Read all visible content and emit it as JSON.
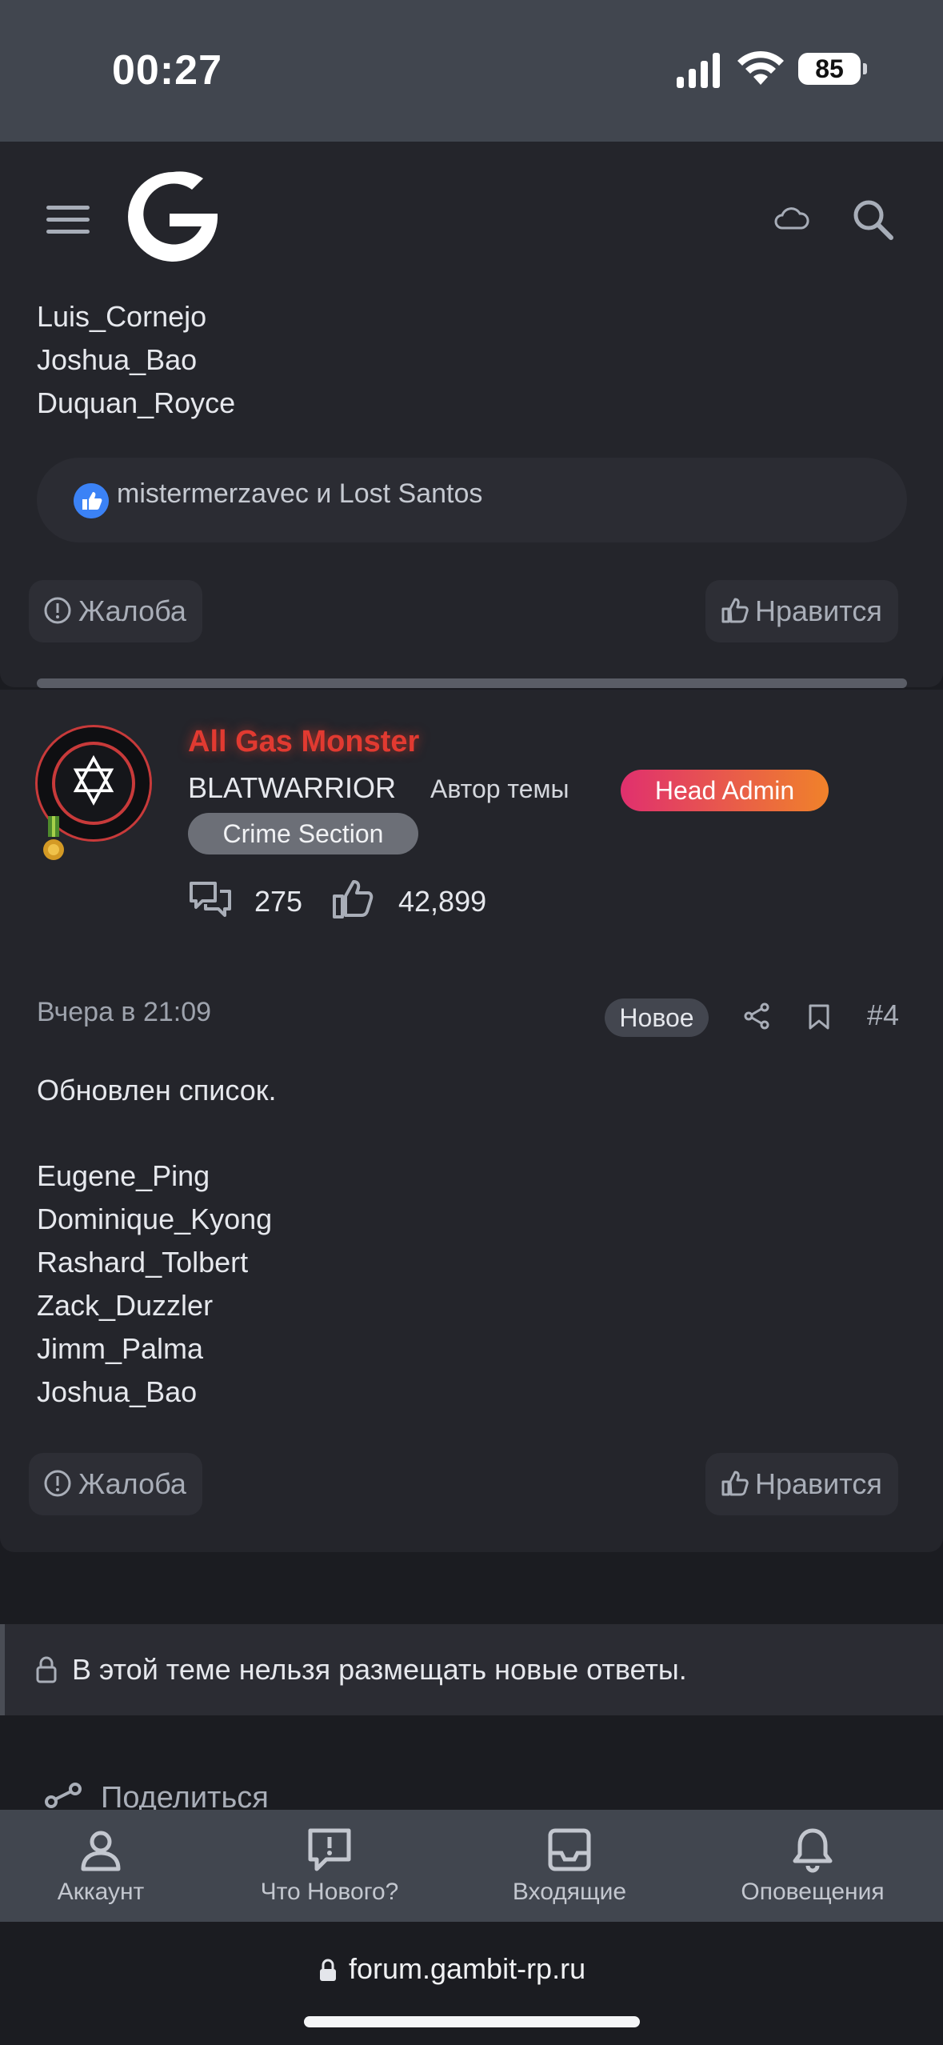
{
  "status_bar": {
    "time": "00:27",
    "battery": "85"
  },
  "header": {
    "logo": "G-logo",
    "icons": [
      "hamburger-icon",
      "cloud-icon",
      "search-icon"
    ]
  },
  "post_prev": {
    "names": [
      "Luis_Cornejo",
      "Joshua_Bao",
      "Duquan_Royce"
    ],
    "likes_text": "mistermerzavec и Lost Santos",
    "report_label": "Жалоба",
    "like_label": "Нравится"
  },
  "post": {
    "author_name": "All Gas Monster",
    "author_title": "BLATWARRIOR",
    "op_label": "Автор темы",
    "badges": [
      "Head Admin",
      "Crime Section"
    ],
    "messages_count": "275",
    "reactions_count": "42,899",
    "date": "Вчера в 21:09",
    "new_badge": "Новое",
    "post_number": "#4",
    "body_first": "Обновлен список.",
    "names": [
      "Eugene_Ping",
      "Dominique_Kyong",
      "Rashard_Tolbert",
      "Zack_Duzzler",
      "Jimm_Palma",
      "Joshua_Bao"
    ],
    "report_label": "Жалоба",
    "like_label": "Нравится"
  },
  "locked_notice": "В этой теме нельзя размещать новые ответы.",
  "share_label": "Поделиться",
  "bottom_nav": [
    {
      "label": "Аккаунт",
      "icon": "account-icon"
    },
    {
      "label": "Что Нового?",
      "icon": "whats-new-icon"
    },
    {
      "label": "Входящие",
      "icon": "inbox-icon"
    },
    {
      "label": "Оповещения",
      "icon": "bell-icon"
    }
  ],
  "url": "forum.gambit-rp.ru",
  "colors": {
    "accent_red": "#e13a31",
    "admin_gradient_start": "#e0306e",
    "admin_gradient_end": "#f0822a"
  }
}
